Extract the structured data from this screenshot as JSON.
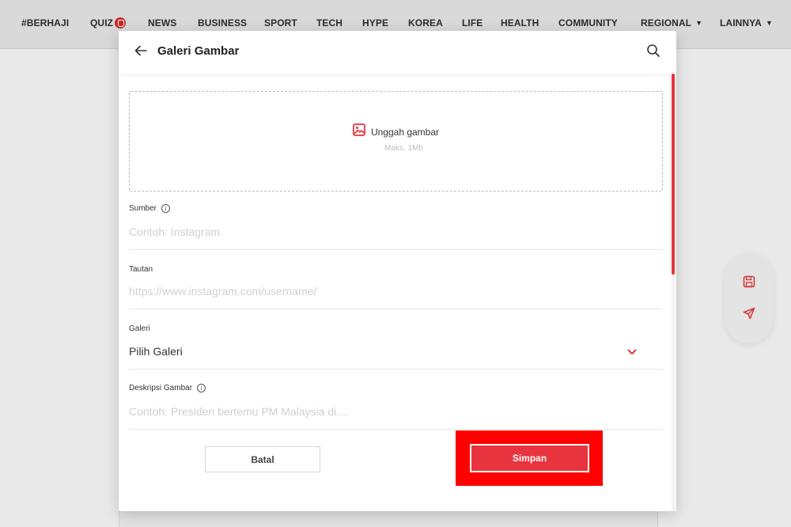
{
  "nav": {
    "items": [
      "#BERHAJI",
      "QUIZ",
      "NEWS",
      "BUSINESS",
      "SPORT",
      "TECH",
      "HYPE",
      "KOREA",
      "LIFE",
      "HEALTH",
      "COMMUNITY",
      "REGIONAL",
      "LAINNYA"
    ],
    "accent_color": "#c62828"
  },
  "modal": {
    "title": "Galeri Gambar",
    "upload": {
      "label": "Unggah gambar",
      "hint": "Maks. 1Mb",
      "icon": "image-icon"
    },
    "fields": {
      "source": {
        "label": "Sumber",
        "placeholder": "Contoh: Instagram",
        "value": ""
      },
      "link": {
        "label": "Tautan",
        "placeholder": "https://www.instagram.com/username/",
        "value": ""
      },
      "gallery": {
        "label": "Galeri",
        "selected": "Pilih Galeri"
      },
      "description": {
        "label": "Deskripsi Gambar",
        "placeholder": "Contoh: Presiden bertemu PM Malaysia di....",
        "value": ""
      }
    },
    "buttons": {
      "cancel": "Batal",
      "save": "Simpan"
    }
  },
  "floating_actions": [
    "save-draft-icon",
    "send-icon"
  ],
  "colors": {
    "accent": "#e8343f",
    "highlight": "#ff0000"
  }
}
